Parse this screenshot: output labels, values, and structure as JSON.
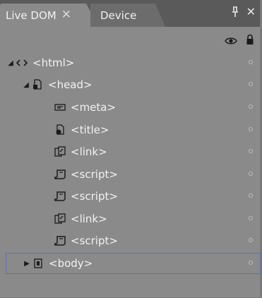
{
  "tabs": [
    {
      "label": "Live DOM",
      "active": true,
      "close": "✕"
    },
    {
      "label": "Device",
      "active": false
    }
  ],
  "window_buttons": {
    "pin": "⊥",
    "close": "✕"
  },
  "toolbar": {
    "eye_icon": "eye-icon",
    "lock_icon": "lock-icon"
  },
  "tree": {
    "nodes": [
      {
        "label": "<html>",
        "icon": "code-brackets-icon",
        "expander": "expanded"
      },
      {
        "label": "<head>",
        "icon": "head-document-icon",
        "expander": "expanded"
      },
      {
        "label": "<meta>",
        "icon": "meta-icon"
      },
      {
        "label": "<title>",
        "icon": "title-icon"
      },
      {
        "label": "<link>",
        "icon": "link-icon"
      },
      {
        "label": "<script>",
        "icon": "script-icon"
      },
      {
        "label": "<script>",
        "icon": "script-icon"
      },
      {
        "label": "<link>",
        "icon": "link-icon"
      },
      {
        "label": "<script>",
        "icon": "script-icon"
      },
      {
        "label": "<body>",
        "icon": "body-icon",
        "expander": "collapsed",
        "selected": true
      }
    ]
  },
  "colors": {
    "panel": "#8a8a8a",
    "tabstrip": "#5a5a5a",
    "selection_border": "#5470c8"
  }
}
